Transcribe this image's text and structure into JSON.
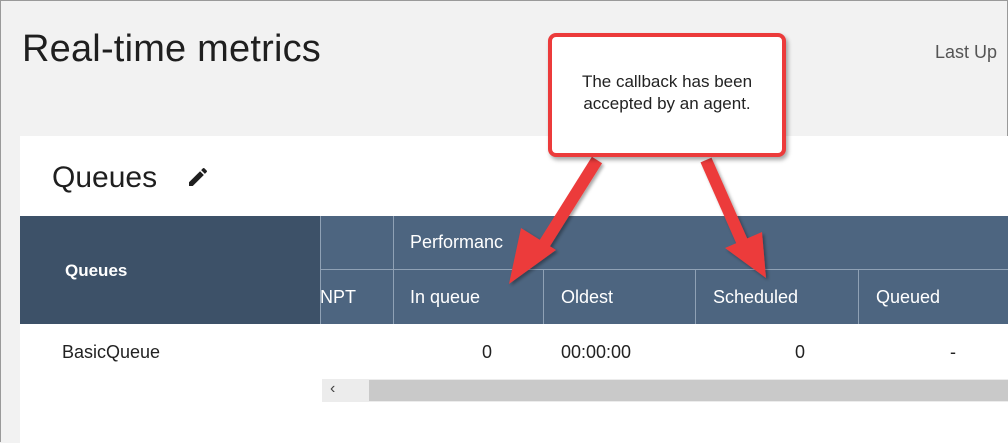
{
  "header": {
    "title": "Real-time metrics",
    "last_updated": "Last Up"
  },
  "queues_panel": {
    "title": "Queues",
    "edit_icon": "pencil-icon",
    "columns": {
      "queues": "Queues",
      "partial_npt": "NPT",
      "performance_group": "Performanc",
      "in_queue": "In queue",
      "oldest": "Oldest",
      "scheduled": "Scheduled",
      "queued": "Queued"
    },
    "rows": [
      {
        "queue": "BasicQueue",
        "in_queue": "0",
        "oldest": "00:00:00",
        "scheduled": "0",
        "queued": "-"
      }
    ],
    "scroll_left": "‹"
  },
  "callout": {
    "text": "The callback has been accepted by an agent.",
    "border_color": "#ec3b3b",
    "arrow_color": "#ec3b3b"
  },
  "colors": {
    "header_bg": "#4d6580",
    "queues_header_bg": "#3d5168"
  }
}
